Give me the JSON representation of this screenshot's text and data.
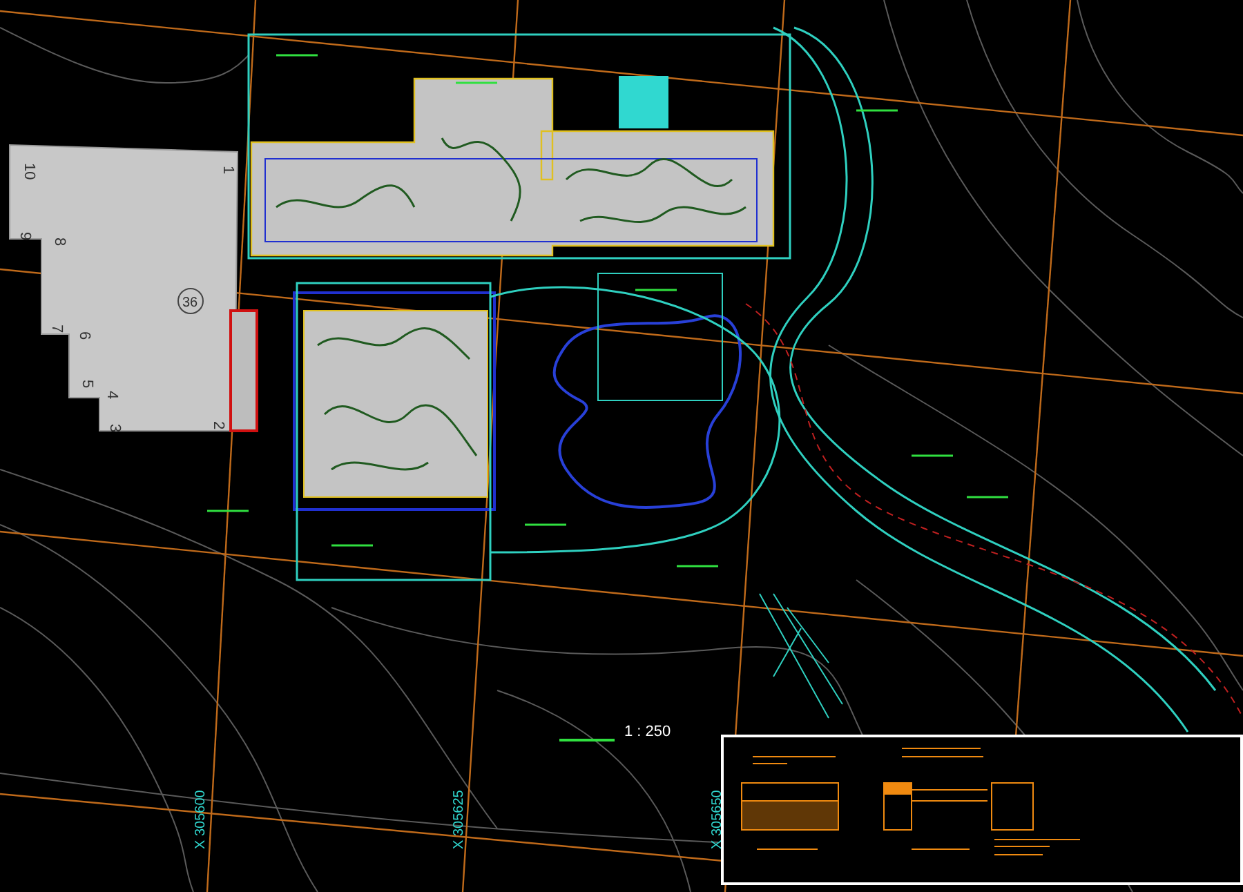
{
  "building": {
    "number": "36",
    "corner_labels": [
      "1",
      "2",
      "3",
      "4",
      "5",
      "6",
      "7",
      "8",
      "9",
      "10"
    ]
  },
  "scale_bar": {
    "scale": "1 : 250"
  },
  "grid_labels": [
    "X 305600",
    "X 305625",
    "X 305650"
  ]
}
